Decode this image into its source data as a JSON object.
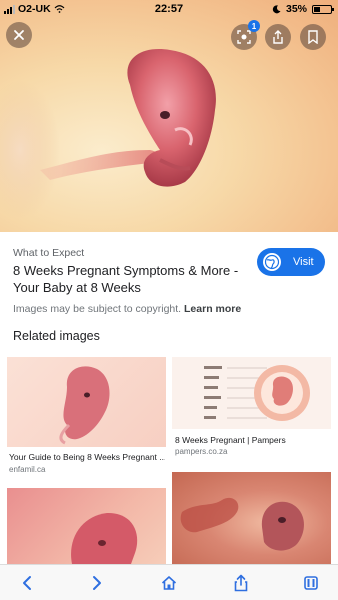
{
  "status": {
    "carrier": "O2-UK",
    "time": "22:57",
    "battery": "35%"
  },
  "viewer": {
    "lens_badge_count": "1"
  },
  "result": {
    "source": "What to Expect",
    "title": "8 Weeks Pregnant Symptoms & More - Your Baby at 8 Weeks",
    "visit_label": "Visit",
    "copyright_text": "Images may be subject to copyright.",
    "learn_more_label": "Learn more"
  },
  "related": {
    "heading": "Related images",
    "items": [
      {
        "title": "Your Guide to Being 8 Weeks Pregnant ...",
        "site": "enfamil.ca"
      },
      {
        "title": "8 Weeks Pregnant | Pampers",
        "site": "pampers.co.za"
      },
      {
        "title": "",
        "site": ""
      },
      {
        "title": "",
        "site": ""
      }
    ]
  },
  "icons": [
    "close-icon",
    "lens-icon",
    "share-icon",
    "bookmark-icon",
    "back-icon",
    "forward-icon",
    "home-icon",
    "share-icon",
    "tabs-icon"
  ],
  "colors": {
    "accent": "#1a73e8",
    "toolbar_icon": "#2f6fe0"
  }
}
